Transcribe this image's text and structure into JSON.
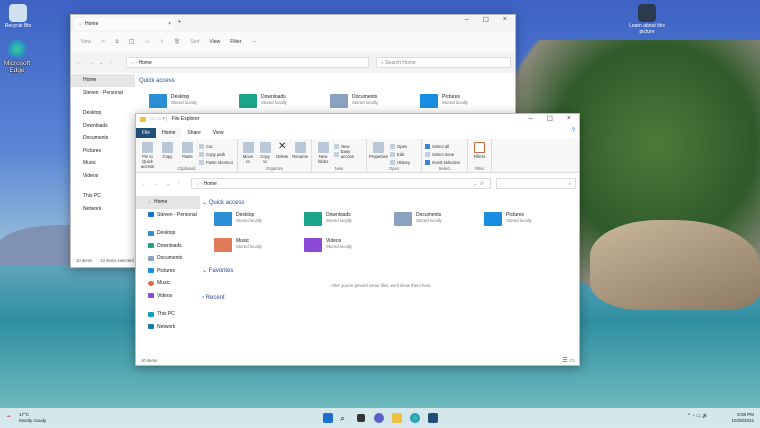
{
  "desktop": {
    "icons": [
      {
        "label": "Recycle Bin"
      },
      {
        "label": "Microsoft Edge"
      },
      {
        "label": "Learn about this picture"
      }
    ]
  },
  "back_window": {
    "tab_title": "Home",
    "toolbar": {
      "new": "New",
      "sort": "Sort",
      "view": "View",
      "filter": "Filter",
      "more": "···"
    },
    "address": "Home",
    "search_placeholder": "Search Home",
    "nav": [
      "Home",
      "Steven - Personal",
      "Desktop",
      "Downloads",
      "Documents",
      "Pictures",
      "Music",
      "Videos",
      "This PC",
      "Network"
    ],
    "section": "Quick access",
    "tiles": [
      {
        "name": "Desktop",
        "sub": "Stored locally"
      },
      {
        "name": "Downloads",
        "sub": "Stored locally"
      },
      {
        "name": "Documents",
        "sub": "Stored locally"
      },
      {
        "name": "Pictures",
        "sub": "Stored locally"
      }
    ],
    "status": "10 items",
    "status2": "10 items selected"
  },
  "front_window": {
    "title": "File Explorer",
    "tabs": [
      "File",
      "Home",
      "Share",
      "View"
    ],
    "ribbon": {
      "clipboard": {
        "label": "Clipboard",
        "pin": "Pin to Quick access",
        "copy": "Copy",
        "paste": "Paste",
        "cut": "Cut",
        "copy_path": "Copy path",
        "paste_shortcut": "Paste shortcut"
      },
      "organize": {
        "label": "Organize",
        "move_to": "Move to",
        "copy_to": "Copy to",
        "delete": "Delete",
        "rename": "Rename"
      },
      "new": {
        "label": "New",
        "new_folder": "New folder",
        "new_item": "New",
        "easy_access": "Easy access"
      },
      "open": {
        "label": "Open",
        "properties": "Properties",
        "open": "Open",
        "edit": "Edit",
        "history": "History"
      },
      "select": {
        "label": "Select",
        "select_all": "Select all",
        "select_none": "Select none",
        "invert": "Invert selection"
      },
      "filter": {
        "label": "Filter",
        "filters": "Filters"
      }
    },
    "address": "Home",
    "nav": [
      "Home",
      "Steven - Personal",
      "Desktop",
      "Downloads",
      "Documents",
      "Pictures",
      "Music",
      "Videos",
      "This PC",
      "Network"
    ],
    "sections": {
      "quick": "Quick access",
      "favorites": "Favorites",
      "recent": "Recent"
    },
    "tiles": [
      {
        "name": "Desktop",
        "sub": "Stored locally"
      },
      {
        "name": "Downloads",
        "sub": "Stored locally"
      },
      {
        "name": "Documents",
        "sub": "Stored locally"
      },
      {
        "name": "Pictures",
        "sub": "Stored locally"
      },
      {
        "name": "Music",
        "sub": "Stored locally"
      },
      {
        "name": "Videos",
        "sub": "Stored locally"
      }
    ],
    "favorites_empty": "After you've pinned some files, we'll show them here.",
    "status": "10 items"
  },
  "taskbar": {
    "weather_temp": "17°C",
    "weather_desc": "Mostly cloudy",
    "time": "8:08 PM",
    "date": "10/28/2022"
  },
  "colors": {
    "desktop": "#FE9A0",
    "accent": "#1a5fb4",
    "file_tab": "#1f4e79",
    "taskbar": "#dcebf0"
  }
}
